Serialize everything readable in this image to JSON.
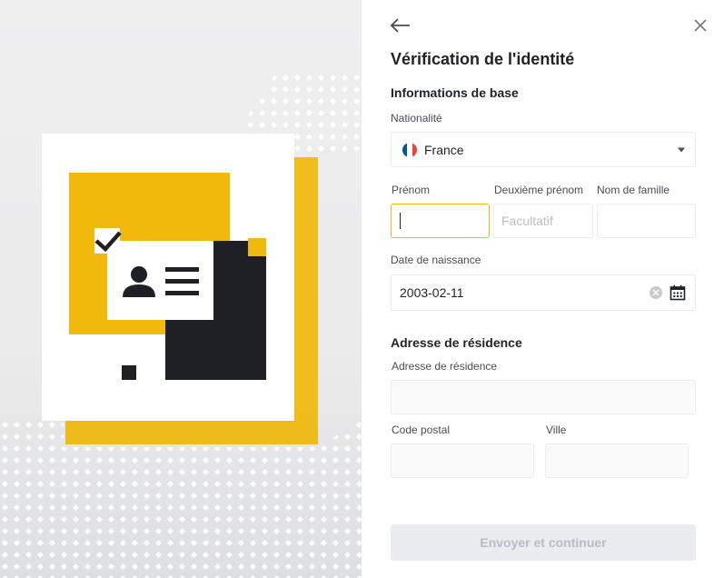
{
  "form": {
    "title": "Vérification de l'identité",
    "basic_section": "Informations de base",
    "nationality": {
      "label": "Nationalité",
      "value": "France",
      "flag_icon": "france-flag-icon"
    },
    "first_name": {
      "label": "Prénom",
      "value": ""
    },
    "middle_name": {
      "label": "Deuxième prénom",
      "placeholder": "Facultatif"
    },
    "last_name": {
      "label": "Nom de famille",
      "value": ""
    },
    "birth_date": {
      "label": "Date de naissance",
      "value": "2003-02-11"
    },
    "residence_section": "Adresse de résidence",
    "address": {
      "label": "Adresse de résidence",
      "value": ""
    },
    "postal_code": {
      "label": "Code postal",
      "value": ""
    },
    "city": {
      "label": "Ville",
      "value": ""
    },
    "submit_label": "Envoyer et continuer"
  },
  "icons": {
    "back": "arrow-left-icon",
    "close": "close-icon",
    "clear": "clear-icon",
    "calendar": "calendar-icon",
    "dropdown": "chevron-down-icon"
  },
  "colors": {
    "accent": "#f0b90b",
    "text": "#1e2329",
    "muted": "#474d57",
    "placeholder": "#b7bdc6",
    "border": "#eaecef"
  }
}
